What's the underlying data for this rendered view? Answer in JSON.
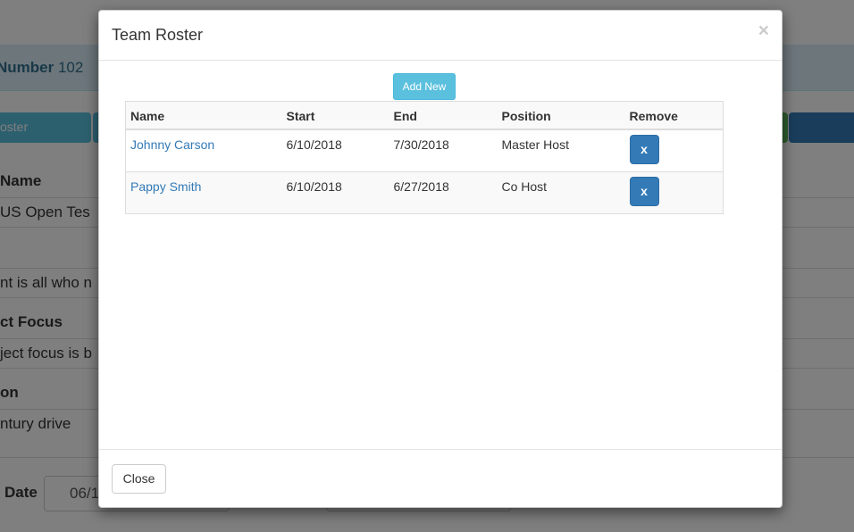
{
  "background": {
    "header_label": "Number",
    "header_value": "102",
    "tab_button": "oster",
    "name_label": "Name",
    "name_value": "US Open Tes",
    "description_value": "nt is all who n",
    "project_focus_label": "ct Focus",
    "project_focus_value": "ject focus is b",
    "location_label": "on",
    "location_value": "ntury drive",
    "date_label": "Date",
    "date_value": "06/1"
  },
  "modal": {
    "title": "Team Roster",
    "close_x": "×",
    "add_new_label": "Add New",
    "close_label": "Close",
    "columns": [
      "Name",
      "Start",
      "End",
      "Position",
      "Remove"
    ],
    "rows": [
      {
        "name": "Johnny Carson",
        "start": "6/10/2018",
        "end": "7/30/2018",
        "position": "Master Host",
        "remove": "x"
      },
      {
        "name": "Pappy Smith",
        "start": "6/10/2018",
        "end": "6/27/2018",
        "position": "Co Host",
        "remove": "x"
      }
    ]
  }
}
